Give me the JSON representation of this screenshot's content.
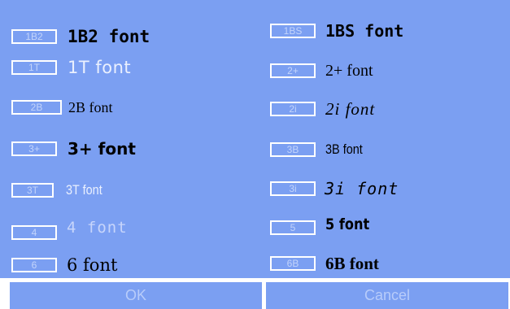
{
  "fonts": {
    "f1b2": {
      "chip": "1B2",
      "label": "1B2 font"
    },
    "f1bs": {
      "chip": "1BS",
      "label": "1BS font"
    },
    "f1t": {
      "chip": "1T",
      "label": "1T font"
    },
    "f2plus": {
      "chip": "2+",
      "label": "2+ font"
    },
    "f2b": {
      "chip": "2B",
      "label": "2B font"
    },
    "f2i": {
      "chip": "2i",
      "label": "2i font"
    },
    "f3plus": {
      "chip": "3+",
      "label": "3+ font"
    },
    "f3b": {
      "chip": "3B",
      "label": "3B font"
    },
    "f3t": {
      "chip": "3T",
      "label": "3T font"
    },
    "f3i": {
      "chip": "3i",
      "label": "3i font"
    },
    "f4": {
      "chip": "4",
      "label": "4 font"
    },
    "f5": {
      "chip": "5",
      "label": "5 font"
    },
    "f6": {
      "chip": "6",
      "label": "6 font"
    },
    "f6b": {
      "chip": "6B",
      "label": "6B font"
    }
  },
  "buttons": {
    "ok": "OK",
    "cancel": "Cancel"
  },
  "colors": {
    "panel_bg": "#7b9ff2",
    "chip_border": "#ffffff",
    "chip_text": "#c3d4fb",
    "button_text": "#b8ccfa"
  }
}
